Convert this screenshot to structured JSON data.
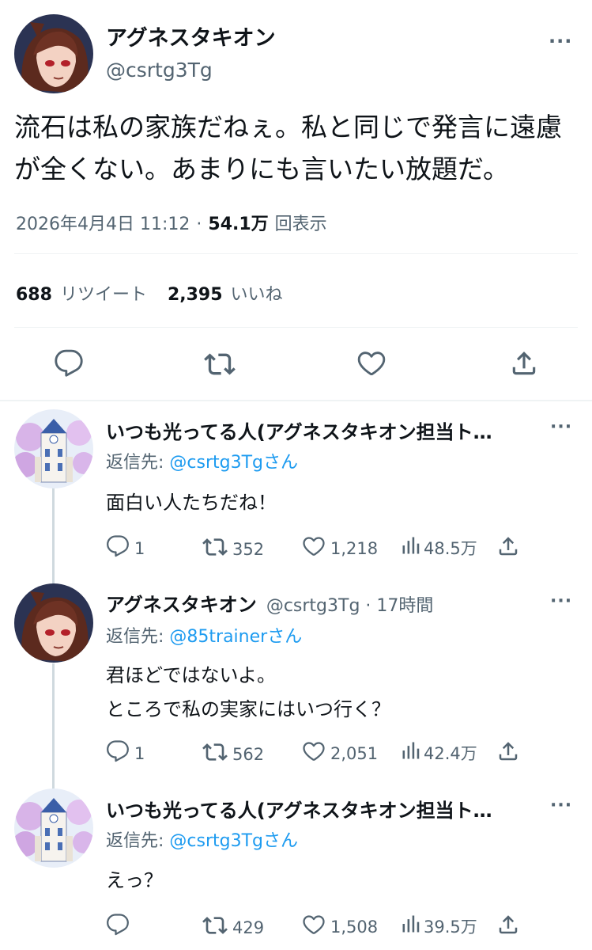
{
  "main_tweet": {
    "display_name": "アグネスタキオン",
    "handle": "@csrtg3Tg",
    "text_line1": "流石は私の家族だねぇ。私と同じで発言に遠慮",
    "text_line2": "が全くない。あまりにも言いたい放題だ。",
    "timestamp": "2026年4月4日 11:12",
    "separator": "·",
    "views": "54.1万",
    "views_label": "回表示",
    "retweets": "688",
    "retweets_label": "リツイート",
    "likes": "2,395",
    "likes_label": "いいね"
  },
  "replies": [
    {
      "display_name": "いつも光ってる人(アグネスタキオン担当ト…",
      "reply_prefix": "返信先: ",
      "reply_to": "@csrtg3Tgさん",
      "text_lines": [
        "面白い人たちだね！"
      ],
      "replies": "1",
      "retweets": "352",
      "likes": "1,218",
      "views": "48.5万"
    },
    {
      "display_name": "アグネスタキオン",
      "handle_time": "@csrtg3Tg · 17時間",
      "reply_prefix": "返信先: ",
      "reply_to": "@85trainerさん",
      "text_lines": [
        "君ほどではないよ。",
        "ところで私の実家にはいつ行く？"
      ],
      "replies": "1",
      "retweets": "562",
      "likes": "2,051",
      "views": "42.4万"
    },
    {
      "display_name": "いつも光ってる人(アグネスタキオン担当ト…",
      "reply_prefix": "返信先: ",
      "reply_to": "@csrtg3Tgさん",
      "text_lines": [
        "えっ？"
      ],
      "replies": "",
      "retweets": "429",
      "likes": "1,508",
      "views": "39.5万"
    }
  ],
  "more_label": "···",
  "colors": {
    "link": "#1d9bf0",
    "secondary": "#536471",
    "divider": "#eff3f4"
  },
  "icons": [
    "reply-icon",
    "retweet-icon",
    "like-icon",
    "share-icon",
    "views-icon",
    "more-icon"
  ]
}
